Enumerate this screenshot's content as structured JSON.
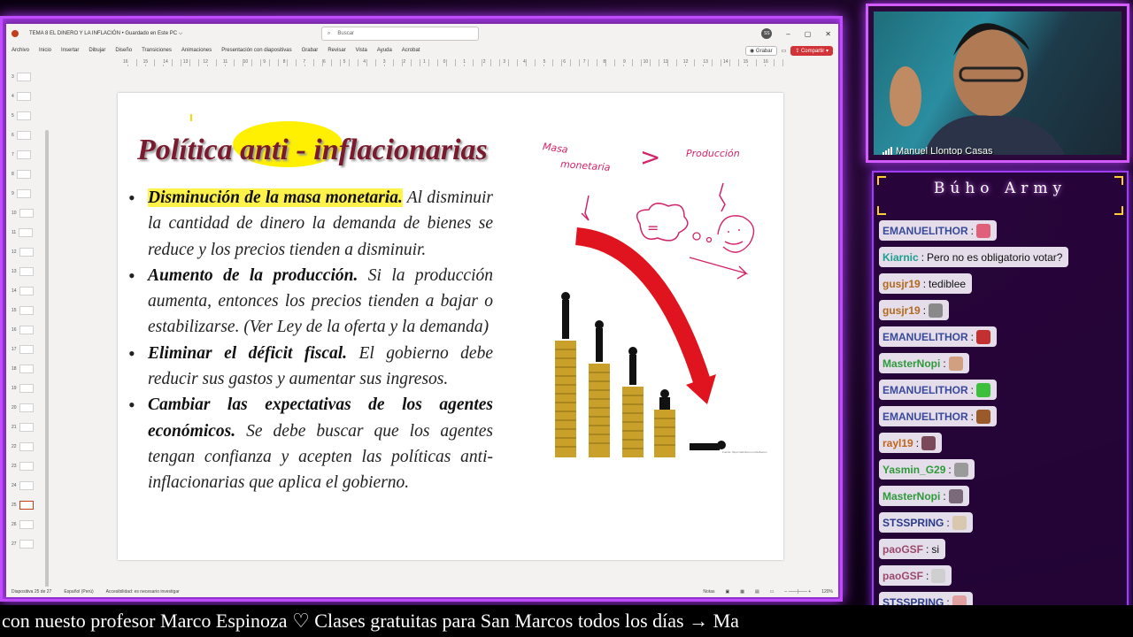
{
  "ppt": {
    "doc_title": "TEMA 8 EL DINERO Y LA INFLACIÓN • Guardado en Este PC ⌵",
    "search_placeholder": "Buscar",
    "user_initials": "SS",
    "menu": [
      "Archivo",
      "Inicio",
      "Insertar",
      "Dibujar",
      "Diseño",
      "Transiciones",
      "Animaciones",
      "Presentación con diapositivas",
      "Grabar",
      "Revisar",
      "Vista",
      "Ayuda",
      "Acrobat"
    ],
    "grabar_label": "Grabar",
    "compartir_label": "Compartir",
    "ruler_numbers": [
      "16",
      "15",
      "14",
      "13",
      "12",
      "11",
      "10",
      "9",
      "8",
      "7",
      "6",
      "5",
      "4",
      "3",
      "2",
      "1",
      "0",
      "1",
      "2",
      "3",
      "4",
      "5",
      "6",
      "7",
      "8",
      "9",
      "10",
      "11",
      "12",
      "13",
      "14",
      "15",
      "16"
    ],
    "thumb_numbers": [
      "3",
      "4",
      "5",
      "6",
      "7",
      "8",
      "9",
      "10",
      "11",
      "12",
      "13",
      "14",
      "15",
      "16",
      "17",
      "18",
      "19",
      "20",
      "21",
      "22",
      "23",
      "24",
      "25",
      "26",
      "27"
    ],
    "status": {
      "slide_info": "Diapositiva 25 de 27",
      "language": "Español (Perú)",
      "accessibility": "Accesibilidad: es necesario investigar",
      "notes": "Notas",
      "zoom": "120%"
    }
  },
  "slide": {
    "title": "Política anti - inflacionarias",
    "bullets": [
      {
        "bold": "Disminución de la masa monetaria.",
        "text": " Al disminuir la cantidad de dinero la demanda de bienes se reduce y los precios tienden a disminuir."
      },
      {
        "bold": "Aumento de la producción.",
        "text": " Si la producción aumenta, entonces los precios tienden a bajar o estabilizarse. (Ver Ley de la oferta y la demanda)"
      },
      {
        "bold": "Eliminar el déficit fiscal.",
        "text": " El gobierno debe reducir sus gastos y aumentar sus ingresos."
      },
      {
        "bold": "Cambiar las expectativas de los agentes económicos.",
        "text": " Se debe buscar que los agentes tengan confianza y acepten las políticas anti-inflacionarias que aplica el gobierno."
      }
    ],
    "ink": {
      "masa": "Masa",
      "monetaria": "monetaria",
      "gt": ">",
      "produccion": "Producción"
    },
    "source": "Fuente: https://definicion.mx/deflacion"
  },
  "cam": {
    "name": "Manuel Llontop Casas"
  },
  "chat": {
    "title": "Búho Army",
    "messages": [
      {
        "user": "EMANUELITHOR",
        "text": "",
        "user_color": "#3a4a9a",
        "emote_color": "#e0607a"
      },
      {
        "user": "Kiarnic",
        "text": "Pero no es obligatorio votar?",
        "user_color": "#1e9e8e",
        "emote_color": ""
      },
      {
        "user": "gusjr19",
        "text": "tediblee",
        "user_color": "#b06a1e",
        "emote_color": ""
      },
      {
        "user": "gusjr19",
        "text": "",
        "user_color": "#b06a1e",
        "emote_color": "#8a8a8a"
      },
      {
        "user": "EMANUELITHOR",
        "text": "",
        "user_color": "#3a4a9a",
        "emote_color": "#c23030"
      },
      {
        "user": "MasterNopi",
        "text": "",
        "user_color": "#2e9a3a",
        "emote_color": "#d0a080"
      },
      {
        "user": "EMANUELITHOR",
        "text": "",
        "user_color": "#3a4a9a",
        "emote_color": "#3cbf3c"
      },
      {
        "user": "EMANUELITHOR",
        "text": "",
        "user_color": "#3a4a9a",
        "emote_color": "#9a5a2a"
      },
      {
        "user": "rayl19",
        "text": "",
        "user_color": "#c0661a",
        "emote_color": "#7a4a5a"
      },
      {
        "user": "Yasmin_G29",
        "text": "",
        "user_color": "#2e9a3a",
        "emote_color": "#9a9a9a"
      },
      {
        "user": "MasterNopi",
        "text": "",
        "user_color": "#2e9a3a",
        "emote_color": "#7a6a7a"
      },
      {
        "user": "STSSPRING",
        "text": "",
        "user_color": "#2a3a8a",
        "emote_color": "#d8c8b0"
      },
      {
        "user": "paoGSF",
        "text": "si",
        "user_color": "#9a4a6a",
        "emote_color": ""
      },
      {
        "user": "paoGSF",
        "text": "",
        "user_color": "#9a4a6a",
        "emote_color": "#cfcfcf"
      },
      {
        "user": "STSSPRING",
        "text": "",
        "user_color": "#2a3a8a",
        "emote_color": "#e0a0a0"
      }
    ]
  },
  "ticker": {
    "text": "con nuesto profesor Marco Espinoza  ♡  Clases gratuitas para San Marcos todos los días  →  Ma"
  }
}
